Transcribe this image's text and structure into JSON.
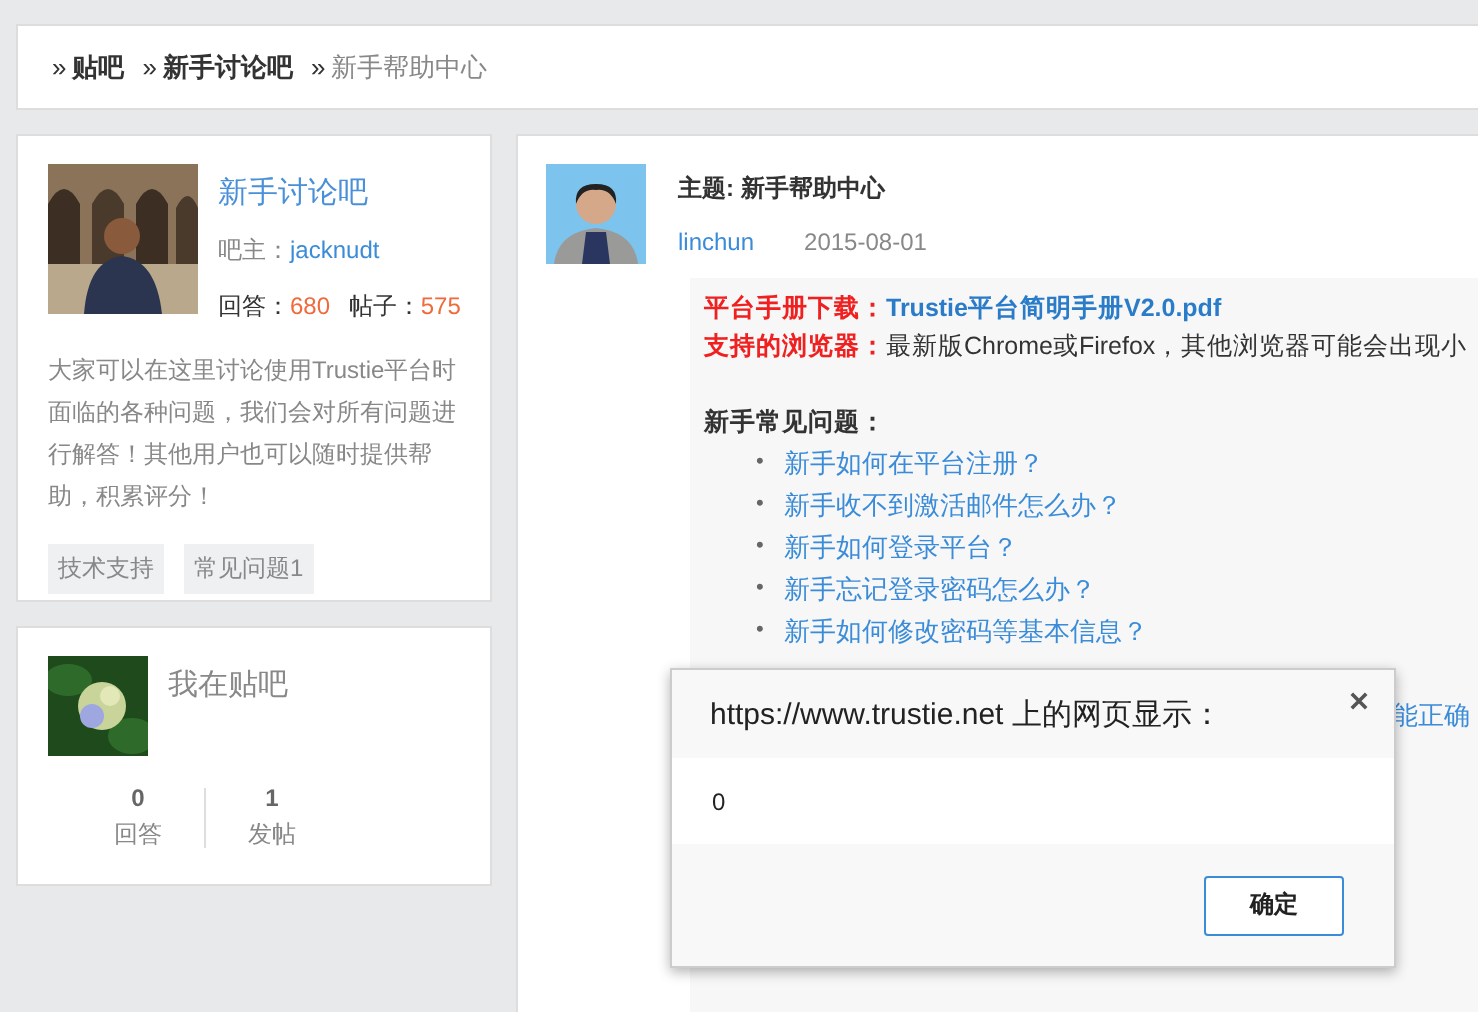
{
  "breadcrumb": [
    {
      "separator": "»",
      "label": "贴吧",
      "bold": true
    },
    {
      "separator": "»",
      "label": "新手讨论吧",
      "bold": true
    },
    {
      "separator": "»",
      "label": "新手帮助中心",
      "bold": false
    }
  ],
  "forum_card": {
    "name": "新手讨论吧",
    "owner_label": "吧主：",
    "owner": "jacknudt",
    "answers_label": "回答：",
    "answers": "680",
    "posts_label": "帖子：",
    "posts": "575",
    "description": "大家可以在这里讨论使用Trustie平台时面临的各种问题，我们会对所有问题进行解答！其他用户也可以随时提供帮助，积累评分！",
    "tags": [
      "技术支持",
      "常见问题1"
    ]
  },
  "my_card": {
    "title": "我在贴吧",
    "stats": [
      {
        "value": "0",
        "label": "回答"
      },
      {
        "value": "1",
        "label": "发帖"
      }
    ]
  },
  "post": {
    "title": "主题: 新手帮助中心",
    "author": "linchun",
    "date": "2015-08-01",
    "manual_label": "平台手册下载：",
    "manual_link": "Trustie平台简明手册V2.0.pdf",
    "browser_label": "支持的浏览器：",
    "browser_text": "最新版Chrome或Firefox，其他浏览器可能会出现小",
    "faq_title": "新手常见问题：",
    "bullet": "•",
    "faq": [
      "新手如何在平台注册？",
      "新手收不到激活邮件怎么办？",
      "新手如何登录平台？",
      "新手忘记登录密码怎么办？",
      "新手如何修改密码等基本信息？"
    ],
    "hidden_line_tail": "能正确"
  },
  "dialog": {
    "title": "https://www.trustie.net 上的网页显示：",
    "message": "0",
    "ok": "确定"
  }
}
